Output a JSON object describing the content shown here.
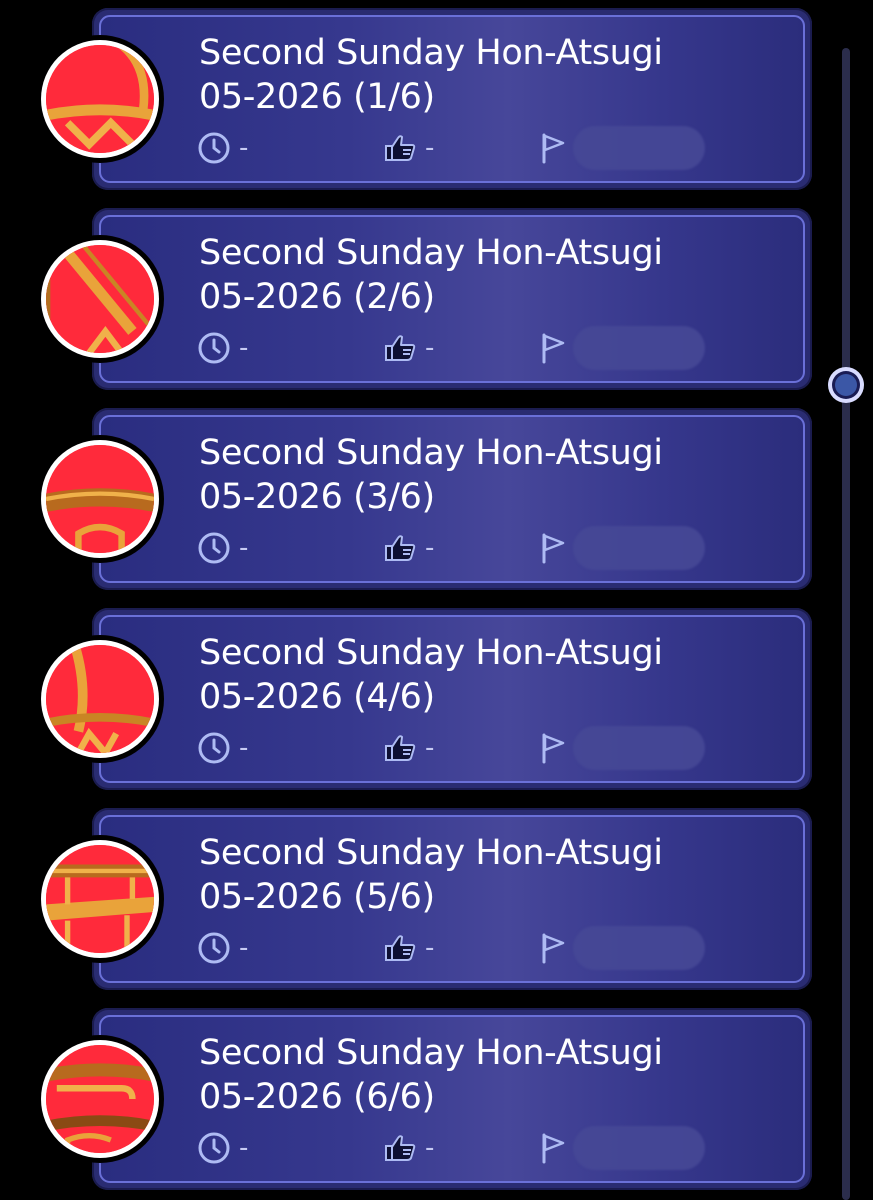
{
  "colors": {
    "card_border": "#6a70d8",
    "card_fill": "#36388e",
    "badge_red": "#ff2a3b",
    "badge_gold": "#e9a33a",
    "stat_text": "#c7cbf3",
    "background": "#000000"
  },
  "icons": {
    "duration": "clock-icon",
    "likes": "thumbs-up-icon",
    "owner": "flag-icon"
  },
  "items": [
    {
      "title": "Second Sunday Hon-Atsugi\n05-2026 (1/6)",
      "duration": "-",
      "likes": "-"
    },
    {
      "title": "Second Sunday Hon-Atsugi\n05-2026 (2/6)",
      "duration": "-",
      "likes": "-"
    },
    {
      "title": "Second Sunday Hon-Atsugi\n05-2026 (3/6)",
      "duration": "-",
      "likes": "-"
    },
    {
      "title": "Second Sunday Hon-Atsugi\n05-2026 (4/6)",
      "duration": "-",
      "likes": "-"
    },
    {
      "title": "Second Sunday Hon-Atsugi\n05-2026 (5/6)",
      "duration": "-",
      "likes": "-"
    },
    {
      "title": "Second Sunday Hon-Atsugi\n05-2026 (6/6)",
      "duration": "-",
      "likes": "-"
    }
  ],
  "scrollbar": {
    "position_fraction": 0.28
  }
}
